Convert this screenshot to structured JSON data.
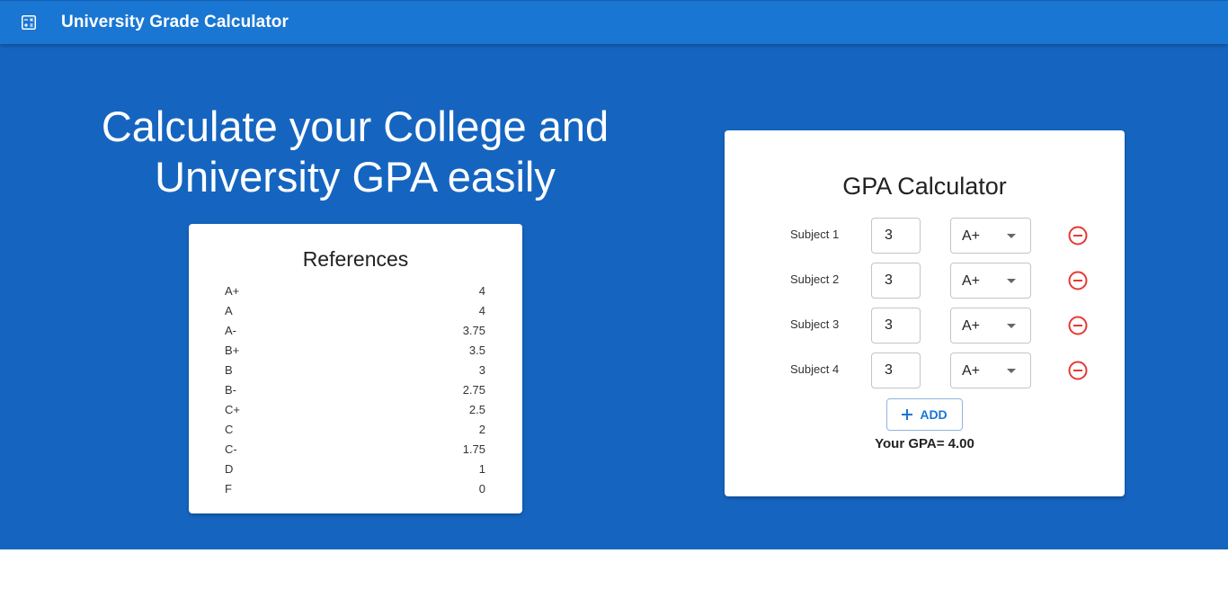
{
  "app": {
    "title": "University Grade Calculator",
    "icon": "calculator-icon",
    "bar_color": "#1976d2"
  },
  "hero": {
    "title": "Calculate your College and University GPA easily",
    "background_color": "#1565c0"
  },
  "references": {
    "title": "References",
    "rows": [
      {
        "grade": "A+",
        "points": "4"
      },
      {
        "grade": "A",
        "points": "4"
      },
      {
        "grade": "A-",
        "points": "3.75"
      },
      {
        "grade": "B+",
        "points": "3.5"
      },
      {
        "grade": "B",
        "points": "3"
      },
      {
        "grade": "B-",
        "points": "2.75"
      },
      {
        "grade": "C+",
        "points": "2.5"
      },
      {
        "grade": "C",
        "points": "2"
      },
      {
        "grade": "C-",
        "points": "1.75"
      },
      {
        "grade": "D",
        "points": "1"
      },
      {
        "grade": "F",
        "points": "0"
      }
    ]
  },
  "calculator": {
    "title": "GPA Calculator",
    "subjects": [
      {
        "label": "Subject 1",
        "credits": "3",
        "grade": "A+"
      },
      {
        "label": "Subject 2",
        "credits": "3",
        "grade": "A+"
      },
      {
        "label": "Subject 3",
        "credits": "3",
        "grade": "A+"
      },
      {
        "label": "Subject 4",
        "credits": "3",
        "grade": "A+"
      }
    ],
    "add_label": "ADD",
    "result_label": "Your GPA=",
    "result_value": "4.00",
    "remove_icon": "remove-circle-icon",
    "remove_color": "#e53935",
    "accent_color": "#1976d2"
  }
}
